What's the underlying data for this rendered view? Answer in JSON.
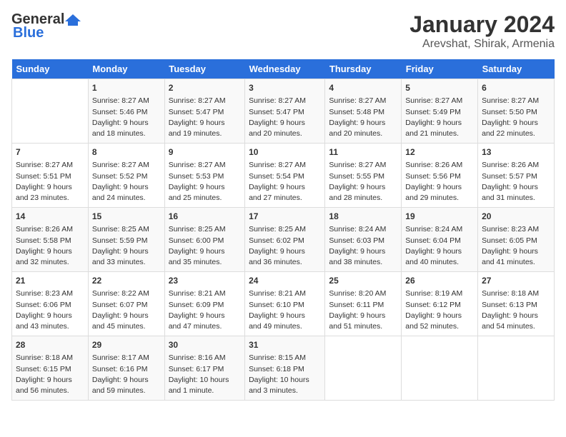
{
  "logo": {
    "general": "General",
    "blue": "Blue"
  },
  "title": "January 2024",
  "location": "Arevshat, Shirak, Armenia",
  "days_of_week": [
    "Sunday",
    "Monday",
    "Tuesday",
    "Wednesday",
    "Thursday",
    "Friday",
    "Saturday"
  ],
  "weeks": [
    [
      {
        "day": "",
        "info": ""
      },
      {
        "day": "1",
        "info": "Sunrise: 8:27 AM\nSunset: 5:46 PM\nDaylight: 9 hours\nand 18 minutes."
      },
      {
        "day": "2",
        "info": "Sunrise: 8:27 AM\nSunset: 5:47 PM\nDaylight: 9 hours\nand 19 minutes."
      },
      {
        "day": "3",
        "info": "Sunrise: 8:27 AM\nSunset: 5:47 PM\nDaylight: 9 hours\nand 20 minutes."
      },
      {
        "day": "4",
        "info": "Sunrise: 8:27 AM\nSunset: 5:48 PM\nDaylight: 9 hours\nand 20 minutes."
      },
      {
        "day": "5",
        "info": "Sunrise: 8:27 AM\nSunset: 5:49 PM\nDaylight: 9 hours\nand 21 minutes."
      },
      {
        "day": "6",
        "info": "Sunrise: 8:27 AM\nSunset: 5:50 PM\nDaylight: 9 hours\nand 22 minutes."
      }
    ],
    [
      {
        "day": "7",
        "info": "Sunrise: 8:27 AM\nSunset: 5:51 PM\nDaylight: 9 hours\nand 23 minutes."
      },
      {
        "day": "8",
        "info": "Sunrise: 8:27 AM\nSunset: 5:52 PM\nDaylight: 9 hours\nand 24 minutes."
      },
      {
        "day": "9",
        "info": "Sunrise: 8:27 AM\nSunset: 5:53 PM\nDaylight: 9 hours\nand 25 minutes."
      },
      {
        "day": "10",
        "info": "Sunrise: 8:27 AM\nSunset: 5:54 PM\nDaylight: 9 hours\nand 27 minutes."
      },
      {
        "day": "11",
        "info": "Sunrise: 8:27 AM\nSunset: 5:55 PM\nDaylight: 9 hours\nand 28 minutes."
      },
      {
        "day": "12",
        "info": "Sunrise: 8:26 AM\nSunset: 5:56 PM\nDaylight: 9 hours\nand 29 minutes."
      },
      {
        "day": "13",
        "info": "Sunrise: 8:26 AM\nSunset: 5:57 PM\nDaylight: 9 hours\nand 31 minutes."
      }
    ],
    [
      {
        "day": "14",
        "info": "Sunrise: 8:26 AM\nSunset: 5:58 PM\nDaylight: 9 hours\nand 32 minutes."
      },
      {
        "day": "15",
        "info": "Sunrise: 8:25 AM\nSunset: 5:59 PM\nDaylight: 9 hours\nand 33 minutes."
      },
      {
        "day": "16",
        "info": "Sunrise: 8:25 AM\nSunset: 6:00 PM\nDaylight: 9 hours\nand 35 minutes."
      },
      {
        "day": "17",
        "info": "Sunrise: 8:25 AM\nSunset: 6:02 PM\nDaylight: 9 hours\nand 36 minutes."
      },
      {
        "day": "18",
        "info": "Sunrise: 8:24 AM\nSunset: 6:03 PM\nDaylight: 9 hours\nand 38 minutes."
      },
      {
        "day": "19",
        "info": "Sunrise: 8:24 AM\nSunset: 6:04 PM\nDaylight: 9 hours\nand 40 minutes."
      },
      {
        "day": "20",
        "info": "Sunrise: 8:23 AM\nSunset: 6:05 PM\nDaylight: 9 hours\nand 41 minutes."
      }
    ],
    [
      {
        "day": "21",
        "info": "Sunrise: 8:23 AM\nSunset: 6:06 PM\nDaylight: 9 hours\nand 43 minutes."
      },
      {
        "day": "22",
        "info": "Sunrise: 8:22 AM\nSunset: 6:07 PM\nDaylight: 9 hours\nand 45 minutes."
      },
      {
        "day": "23",
        "info": "Sunrise: 8:21 AM\nSunset: 6:09 PM\nDaylight: 9 hours\nand 47 minutes."
      },
      {
        "day": "24",
        "info": "Sunrise: 8:21 AM\nSunset: 6:10 PM\nDaylight: 9 hours\nand 49 minutes."
      },
      {
        "day": "25",
        "info": "Sunrise: 8:20 AM\nSunset: 6:11 PM\nDaylight: 9 hours\nand 51 minutes."
      },
      {
        "day": "26",
        "info": "Sunrise: 8:19 AM\nSunset: 6:12 PM\nDaylight: 9 hours\nand 52 minutes."
      },
      {
        "day": "27",
        "info": "Sunrise: 8:18 AM\nSunset: 6:13 PM\nDaylight: 9 hours\nand 54 minutes."
      }
    ],
    [
      {
        "day": "28",
        "info": "Sunrise: 8:18 AM\nSunset: 6:15 PM\nDaylight: 9 hours\nand 56 minutes."
      },
      {
        "day": "29",
        "info": "Sunrise: 8:17 AM\nSunset: 6:16 PM\nDaylight: 9 hours\nand 59 minutes."
      },
      {
        "day": "30",
        "info": "Sunrise: 8:16 AM\nSunset: 6:17 PM\nDaylight: 10 hours\nand 1 minute."
      },
      {
        "day": "31",
        "info": "Sunrise: 8:15 AM\nSunset: 6:18 PM\nDaylight: 10 hours\nand 3 minutes."
      },
      {
        "day": "",
        "info": ""
      },
      {
        "day": "",
        "info": ""
      },
      {
        "day": "",
        "info": ""
      }
    ]
  ]
}
